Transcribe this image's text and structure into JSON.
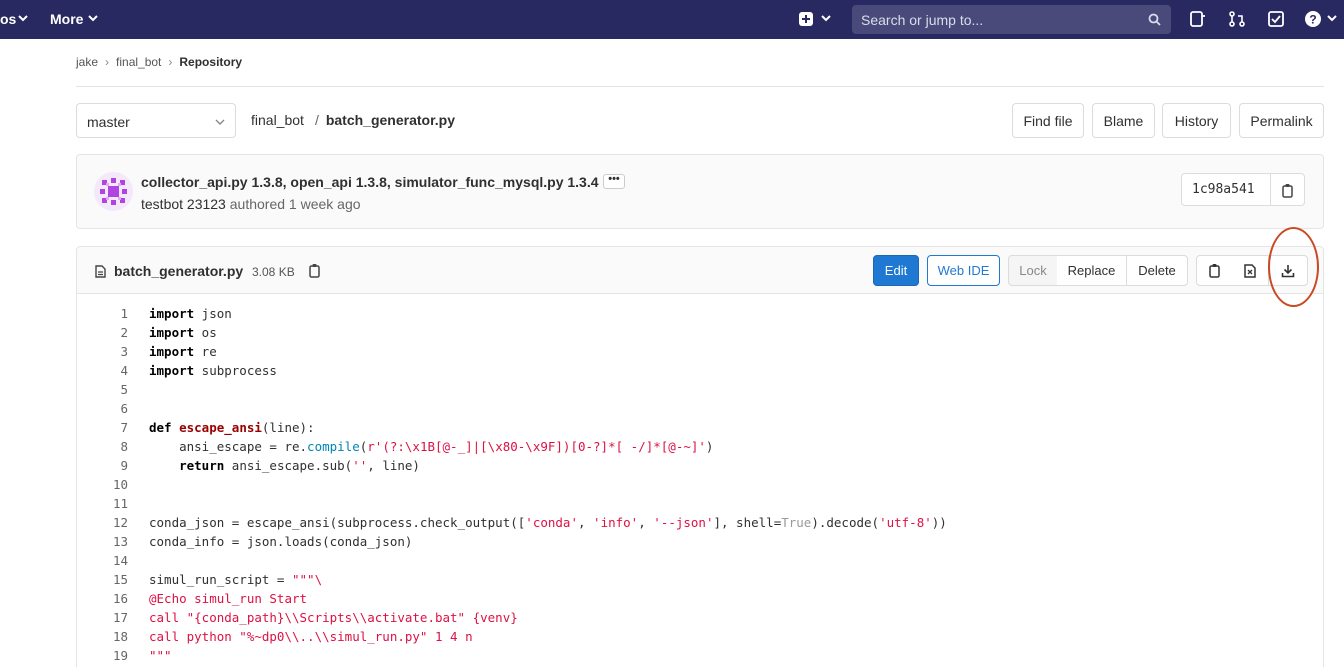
{
  "topnav": {
    "left_fragment": "os",
    "more_label": "More",
    "search_placeholder": "Search or jump to..."
  },
  "breadcrumb": [
    "jake",
    "final_bot",
    "Repository"
  ],
  "branch": "master",
  "path": {
    "repo": "final_bot",
    "file": "batch_generator.py"
  },
  "actions": [
    "Find file",
    "Blame",
    "History",
    "Permalink"
  ],
  "commit": {
    "title": "collector_api.py 1.3.8, open_api 1.3.8, simulator_func_mysql.py 1.3.4",
    "ellipsis": "•••",
    "author": "testbot 23123",
    "meta": " authored 1 week ago",
    "sha": "1c98a541"
  },
  "file": {
    "name": "batch_generator.py",
    "size": "3.08 KB",
    "buttons": {
      "edit": "Edit",
      "webide": "Web IDE",
      "lock": "Lock",
      "replace": "Replace",
      "delete": "Delete"
    }
  },
  "code_lines": [
    "import json",
    "import os",
    "import re",
    "import subprocess",
    "",
    "",
    "def escape_ansi(line):",
    "    ansi_escape = re.compile(r'(?:\\x1B[@-_]|[\\x80-\\x9F])[0-?]*[ -/]*[@-~]')",
    "    return ansi_escape.sub('', line)",
    "",
    "",
    "conda_json = escape_ansi(subprocess.check_output(['conda', 'info', '--json'], shell=True).decode('utf-8'))",
    "conda_info = json.loads(conda_json)",
    "",
    "simul_run_script = \"\"\"\\",
    "@Echo simul_run Start",
    "call \"{conda_path}\\\\Scripts\\\\activate.bat\" {venv}",
    "call python \"%~dp0\\\\..\\\\simul_run.py\" 1 4 n",
    "\"\"\""
  ]
}
